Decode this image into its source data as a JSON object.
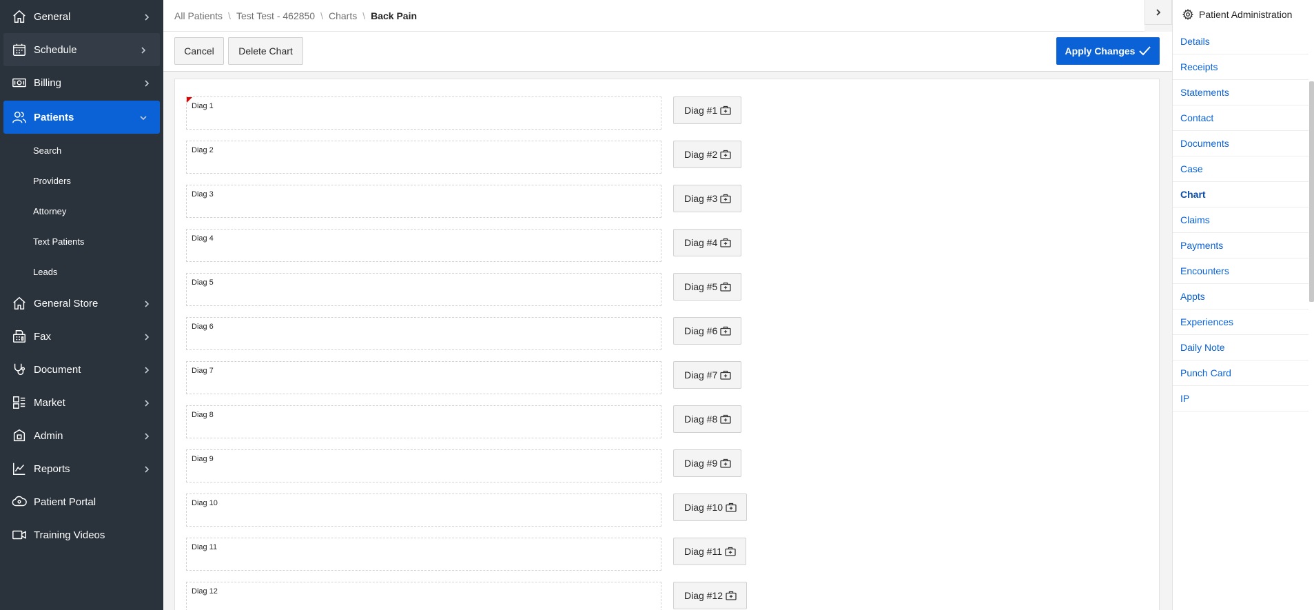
{
  "sidebar": {
    "items": [
      {
        "label": "General",
        "icon": "home-icon",
        "chevron": "right"
      },
      {
        "label": "Schedule",
        "icon": "calendar-icon",
        "chevron": "right"
      },
      {
        "label": "Billing",
        "icon": "money-icon",
        "chevron": "right"
      },
      {
        "label": "Patients",
        "icon": "users-icon",
        "chevron": "down",
        "active": true
      },
      {
        "label": "General Store",
        "icon": "home-icon",
        "chevron": "right"
      },
      {
        "label": "Fax",
        "icon": "fax-icon",
        "chevron": "right"
      },
      {
        "label": "Document",
        "icon": "stethoscope-icon",
        "chevron": "right"
      },
      {
        "label": "Market",
        "icon": "market-icon",
        "chevron": "right"
      },
      {
        "label": "Admin",
        "icon": "admin-icon",
        "chevron": "right"
      },
      {
        "label": "Reports",
        "icon": "chart-line-icon",
        "chevron": "right"
      },
      {
        "label": "Patient Portal",
        "icon": "portal-icon"
      },
      {
        "label": "Training Videos",
        "icon": "video-icon"
      }
    ],
    "patients_sub": [
      "Search",
      "Providers",
      "Attorney",
      "Text Patients",
      "Leads"
    ]
  },
  "breadcrumb": {
    "items": [
      "All Patients",
      "Test Test - 462850",
      "Charts"
    ],
    "current": "Back Pain"
  },
  "toolbar": {
    "cancel_label": "Cancel",
    "delete_label": "Delete Chart",
    "apply_label": "Apply Changes"
  },
  "diagnoses": [
    {
      "label": "Diag 1",
      "button": "Diag #1",
      "required": true
    },
    {
      "label": "Diag 2",
      "button": "Diag #2"
    },
    {
      "label": "Diag 3",
      "button": "Diag #3"
    },
    {
      "label": "Diag 4",
      "button": "Diag #4"
    },
    {
      "label": "Diag 5",
      "button": "Diag #5"
    },
    {
      "label": "Diag 6",
      "button": "Diag #6"
    },
    {
      "label": "Diag 7",
      "button": "Diag #7"
    },
    {
      "label": "Diag 8",
      "button": "Diag #8"
    },
    {
      "label": "Diag 9",
      "button": "Diag #9"
    },
    {
      "label": "Diag 10",
      "button": "Diag #10"
    },
    {
      "label": "Diag 11",
      "button": "Diag #11"
    },
    {
      "label": "Diag 12",
      "button": "Diag #12"
    }
  ],
  "right_panel": {
    "title": "Patient Administration",
    "items": [
      "Details",
      "Receipts",
      "Statements",
      "Contact",
      "Documents",
      "Case",
      "Chart",
      "Claims",
      "Payments",
      "Encounters",
      "Appts",
      "Experiences",
      "Daily Note",
      "Punch Card",
      "IP"
    ],
    "active": "Chart"
  },
  "colors": {
    "sidebar_bg": "#2a323c",
    "accent": "#0a62d6",
    "required_flag": "#e00000"
  }
}
